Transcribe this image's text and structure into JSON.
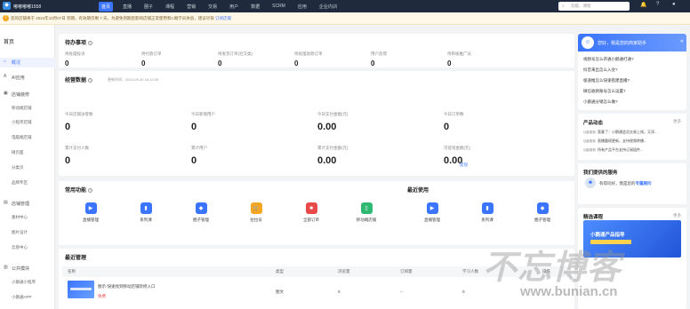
{
  "topbar": {
    "shop_name": "嘟嘟嘟嘟1558",
    "nav": [
      "首页",
      "直播",
      "圈子",
      "课程",
      "营销",
      "交易",
      "用户",
      "数据",
      "SCRM",
      "应用",
      "企业内训"
    ],
    "active_index": 0,
    "search_placeholder": "功能、课程"
  },
  "notice": {
    "text": "您的店铺将于 2024年10月07日 到期，有效期仅剩 7 天，为避免到期后影响店铺正常使用和C端学员体验，建议尽快",
    "link": "订阅店铺"
  },
  "sidebar": {
    "home": "首页",
    "items": [
      {
        "label": "概况",
        "icon": "home-icon",
        "active": true
      },
      {
        "label": "AI应用",
        "icon": "ai-icon",
        "active": false
      },
      {
        "label": "店铺装修",
        "icon": "shop-icon",
        "active": false
      },
      {
        "label": "店铺管理",
        "icon": "manage-icon",
        "active": false
      },
      {
        "label": "公共模块",
        "icon": "module-icon",
        "active": false
      }
    ],
    "sub1": [
      "移动端店铺",
      "小程序店铺",
      "电脑端店铺",
      "微页面",
      "分类页",
      "品牌专区"
    ],
    "sub2": [
      "素材中心",
      "图片设计",
      "云盘中心"
    ],
    "sub3": [
      "小鹅通小程序",
      "小鹅通APP"
    ]
  },
  "todo": {
    "title": "待办事项",
    "items": [
      {
        "label": "待处理投诉",
        "value": "0"
      },
      {
        "label": "待付款订单",
        "value": "0"
      },
      {
        "label": "待发货订单(社交类)",
        "value": "0"
      },
      {
        "label": "待处理退款订单",
        "value": "0"
      },
      {
        "label": "用户反馈",
        "value": "0"
      },
      {
        "label": "待审核推广员",
        "value": "0"
      }
    ]
  },
  "stats": {
    "title": "经营数据",
    "updated": "更新时间：2024-09-30 16:12:09",
    "items": [
      {
        "label": "今日店铺访客数",
        "value": "0"
      },
      {
        "label": "今日新增用户",
        "value": "0"
      },
      {
        "label": "今日支付金额(元)",
        "value": "0.00"
      },
      {
        "label": "今日订单数",
        "value": "0"
      },
      {
        "label": "累计支付人数",
        "value": "0"
      },
      {
        "label": "累计用户",
        "value": "0"
      },
      {
        "label": "累计支付金额(元)",
        "value": "0.00"
      },
      {
        "label": "可提现金额(元)",
        "value": "0.00"
      }
    ],
    "withdraw_link": "提现"
  },
  "functions": {
    "title": "常用功能",
    "items": [
      {
        "label": "直播管理",
        "icon": "live-icon",
        "color": "#3a74ff"
      },
      {
        "label": "系列课",
        "icon": "series-icon",
        "color": "#3a74ff"
      },
      {
        "label": "圈子管理",
        "icon": "circle-icon",
        "color": "#3a74ff"
      },
      {
        "label": "拉拉号",
        "icon": "cart-icon",
        "color": "#f5a623"
      },
      {
        "label": "全部订单",
        "icon": "order-icon",
        "color": "#e84a4a"
      },
      {
        "label": "移动端店铺",
        "icon": "mobile-icon",
        "color": "#2eb872"
      }
    ]
  },
  "recent_used": {
    "title": "最近使用",
    "items": [
      {
        "label": "直播管理",
        "icon": "live-icon",
        "color": "#3a74ff"
      },
      {
        "label": "系列课",
        "icon": "series-icon",
        "color": "#3a74ff"
      },
      {
        "label": "圈子管理",
        "icon": "circle-icon",
        "color": "#3a74ff"
      }
    ]
  },
  "recent_manage": {
    "title": "最近管理",
    "columns": [
      "名称",
      "类型",
      "浏览量",
      "订阅量",
      "学习人数",
      "操作"
    ],
    "rows": [
      {
        "name": "图示-快速找到移动店铺装修入口",
        "tag": "免费",
        "type": "图文",
        "views": "0",
        "subs": "--",
        "learners": "0"
      }
    ]
  },
  "assistant": {
    "greeting": "您好，我是您的商家助手",
    "questions": [
      "视频号怎么开通小鹅通打通?",
      "抖音来出怎么入驻?",
      "极速推怎么快速搭建直播?",
      "微信收款账号怎么设置?",
      "小鹅通分销怎么做?"
    ]
  },
  "product_news": {
    "title": "产品动态",
    "more": "更多",
    "items": [
      {
        "tag": "功能更新",
        "text": "直客了：小鹅通会员交易上线，又添..."
      },
      {
        "tag": "功能更新",
        "text": "直播重磅更新，支持视频转播..."
      },
      {
        "tag": "功能更新",
        "text": "所有产品平台支持订阅组件..."
      }
    ]
  },
  "service": {
    "title": "我们提供的服务",
    "text": "有得问好，我是您的",
    "highlight": "专属顾问"
  },
  "courses": {
    "title": "精选课程",
    "more": "更多",
    "banner_title": "小鹅通产品指导"
  },
  "watermark": {
    "main": "不忘博客",
    "url": "www.bunian.cn"
  }
}
